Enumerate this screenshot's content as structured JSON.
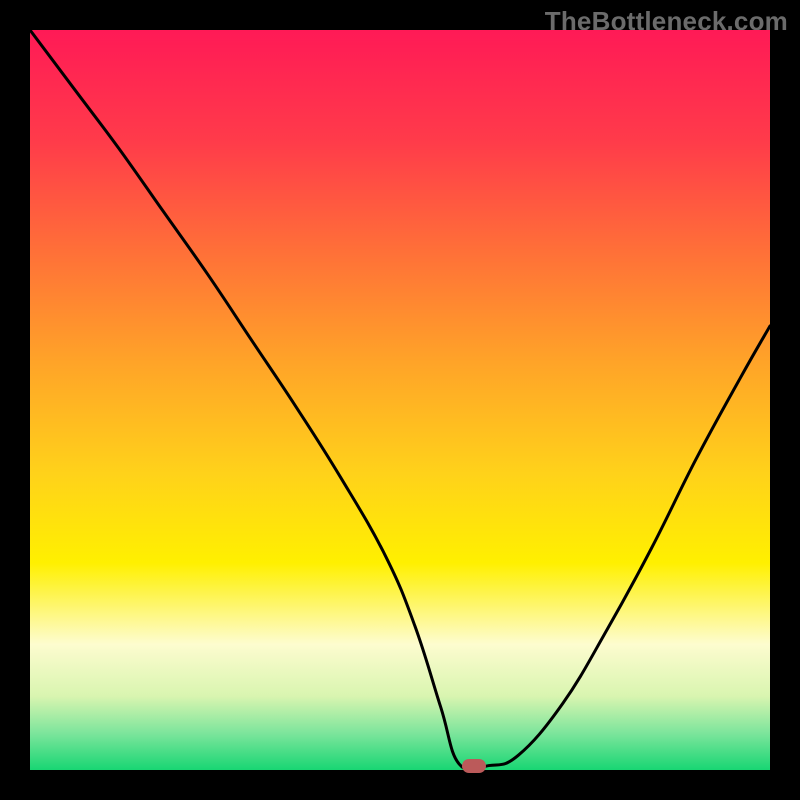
{
  "watermark": "TheBottleneck.com",
  "colors": {
    "background": "#000000",
    "gradient_stops": [
      {
        "offset": 0.0,
        "color": "#ff1a56"
      },
      {
        "offset": 0.15,
        "color": "#ff3b4a"
      },
      {
        "offset": 0.3,
        "color": "#ff7038"
      },
      {
        "offset": 0.45,
        "color": "#ffa428"
      },
      {
        "offset": 0.6,
        "color": "#ffd21a"
      },
      {
        "offset": 0.72,
        "color": "#fff000"
      },
      {
        "offset": 0.83,
        "color": "#fdfccf"
      },
      {
        "offset": 0.9,
        "color": "#d9f5b0"
      },
      {
        "offset": 0.95,
        "color": "#7de59c"
      },
      {
        "offset": 1.0,
        "color": "#18d673"
      }
    ],
    "curve": "#000000",
    "marker": "#bb5a5a"
  },
  "chart_data": {
    "type": "line",
    "title": "",
    "xlabel": "",
    "ylabel": "",
    "xlim": [
      0,
      100
    ],
    "ylim": [
      0,
      100
    ],
    "grid": false,
    "series": [
      {
        "name": "bottleneck-curve",
        "x": [
          0,
          6,
          12,
          18,
          24,
          30,
          36,
          42,
          48,
          52,
          55.5,
          58,
          62,
          66,
          72,
          78,
          84,
          90,
          96,
          100
        ],
        "values": [
          100,
          92,
          84,
          75.5,
          67,
          58,
          49,
          39.5,
          29,
          19.5,
          8.5,
          0.8,
          0.6,
          2,
          9,
          19,
          30,
          42,
          53,
          60
        ]
      }
    ],
    "annotations": [
      {
        "name": "min-marker",
        "x": 60,
        "y": 0.6
      }
    ]
  }
}
